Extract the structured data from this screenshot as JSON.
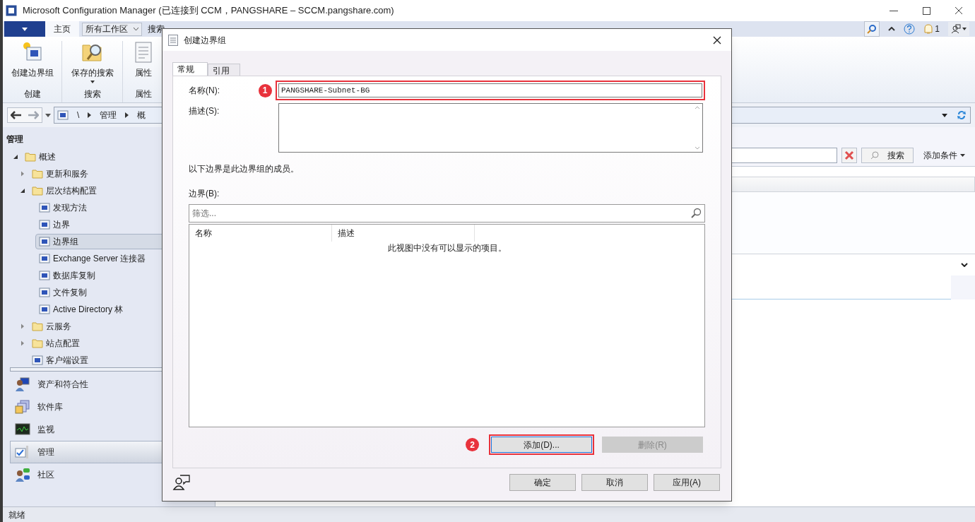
{
  "window": {
    "title": "Microsoft Configuration Manager (已连接到 CCM，PANGSHARE – SCCM.pangshare.com)"
  },
  "toolbar": {
    "tabs": [
      {
        "label": "主页",
        "selected": true
      }
    ],
    "workspace_dropdown": "所有工作区",
    "search_tab": "搜索",
    "notification_count": "1"
  },
  "ribbon": {
    "groups": [
      {
        "label": "创建",
        "button": "创建边界组",
        "has_dropdown": false
      },
      {
        "label": "搜索",
        "button": "保存的搜索",
        "has_dropdown": true
      },
      {
        "label": "属性",
        "button": "属性",
        "has_dropdown": false
      }
    ]
  },
  "breadcrumb": [
    "\\",
    "管理",
    "概"
  ],
  "sidebar": {
    "title": "管理",
    "tree": [
      {
        "label": "概述",
        "expanded": true,
        "selected": false,
        "children": [
          {
            "label": "更新和服务",
            "expanded": false,
            "selected": false
          },
          {
            "label": "层次结构配置",
            "expanded": true,
            "selected": false,
            "children": [
              {
                "label": "发现方法",
                "selected": false
              },
              {
                "label": "边界",
                "selected": false
              },
              {
                "label": "边界组",
                "selected": true
              },
              {
                "label": "Exchange Server 连接器",
                "selected": false
              },
              {
                "label": "数据库复制",
                "selected": false
              },
              {
                "label": "文件复制",
                "selected": false
              },
              {
                "label": "Active Directory 林",
                "selected": false
              }
            ]
          },
          {
            "label": "云服务",
            "expanded": false,
            "selected": false
          },
          {
            "label": "站点配置",
            "expanded": false,
            "selected": false
          },
          {
            "label": "客户端设置",
            "selected": false
          }
        ]
      }
    ],
    "nav": [
      {
        "label": "资产和符合性",
        "selected": false
      },
      {
        "label": "软件库",
        "selected": false
      },
      {
        "label": "监视",
        "selected": false
      },
      {
        "label": "管理",
        "selected": true
      },
      {
        "label": "社区",
        "selected": false
      }
    ]
  },
  "content": {
    "search_button": "搜索",
    "add_criteria": "添加条件"
  },
  "status_bar": "就绪",
  "dialog": {
    "title": "创建边界组",
    "tabs": [
      {
        "label": "常规",
        "selected": true
      },
      {
        "label": "引用",
        "selected": false
      }
    ],
    "name": {
      "label": "名称(N):",
      "value": "PANGSHARE-Subnet-BG",
      "highlighted": true,
      "callout": "1"
    },
    "description": {
      "label": "描述(S):"
    },
    "members_note": "以下边界是此边界组的成员。",
    "boundaries": {
      "label": "边界(B):",
      "filter_placeholder": "筛选...",
      "columns": [
        "名称",
        "描述"
      ],
      "empty_message": "此视图中没有可以显示的项目。"
    },
    "buttons": [
      {
        "label": "添加(D)...",
        "disabled": false,
        "highlighted": true,
        "callout": "2"
      },
      {
        "label": "删除(R)",
        "disabled": true,
        "highlighted": false
      }
    ],
    "footer_buttons": [
      "确定",
      "取消",
      "应用(A)"
    ]
  }
}
